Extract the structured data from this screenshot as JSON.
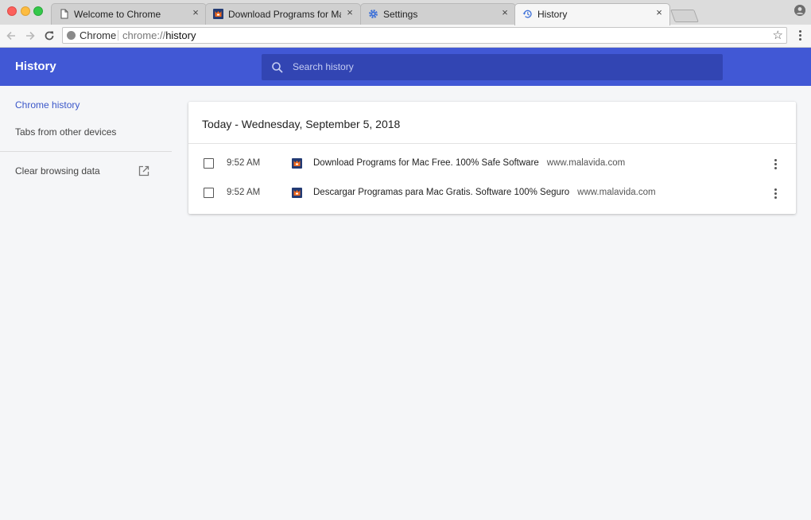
{
  "tabs": [
    {
      "title": "Welcome to Chrome",
      "icon": "document-icon"
    },
    {
      "title": "Download Programs for Mac Fr",
      "icon": "malavida-favicon-icon"
    },
    {
      "title": "Settings",
      "icon": "gear-icon"
    },
    {
      "title": "History",
      "icon": "history-icon",
      "active": true
    }
  ],
  "tab_close_glyph": "×",
  "toolbar": {
    "omnibox_label": "Chrome",
    "url_prefix": "chrome://",
    "url_host": "history"
  },
  "header": {
    "title": "History",
    "search_placeholder": "Search history"
  },
  "sidebar": {
    "items": [
      {
        "label": "Chrome history",
        "selected": true
      },
      {
        "label": "Tabs from other devices"
      },
      {
        "label": "Clear browsing data"
      }
    ]
  },
  "card": {
    "date_heading": "Today - Wednesday, September 5, 2018",
    "entries": [
      {
        "time": "9:52 AM",
        "title": "Download Programs for Mac Free. 100% Safe Software",
        "domain": "www.malavida.com"
      },
      {
        "time": "9:52 AM",
        "title": "Descargar Programas para Mac Gratis. Software 100% Seguro",
        "domain": "www.malavida.com"
      }
    ]
  },
  "colors": {
    "header": "#4158d5",
    "search_box": "#3245b3",
    "selected_nav": "#3b57c9",
    "page_background": "#f5f6f8"
  }
}
